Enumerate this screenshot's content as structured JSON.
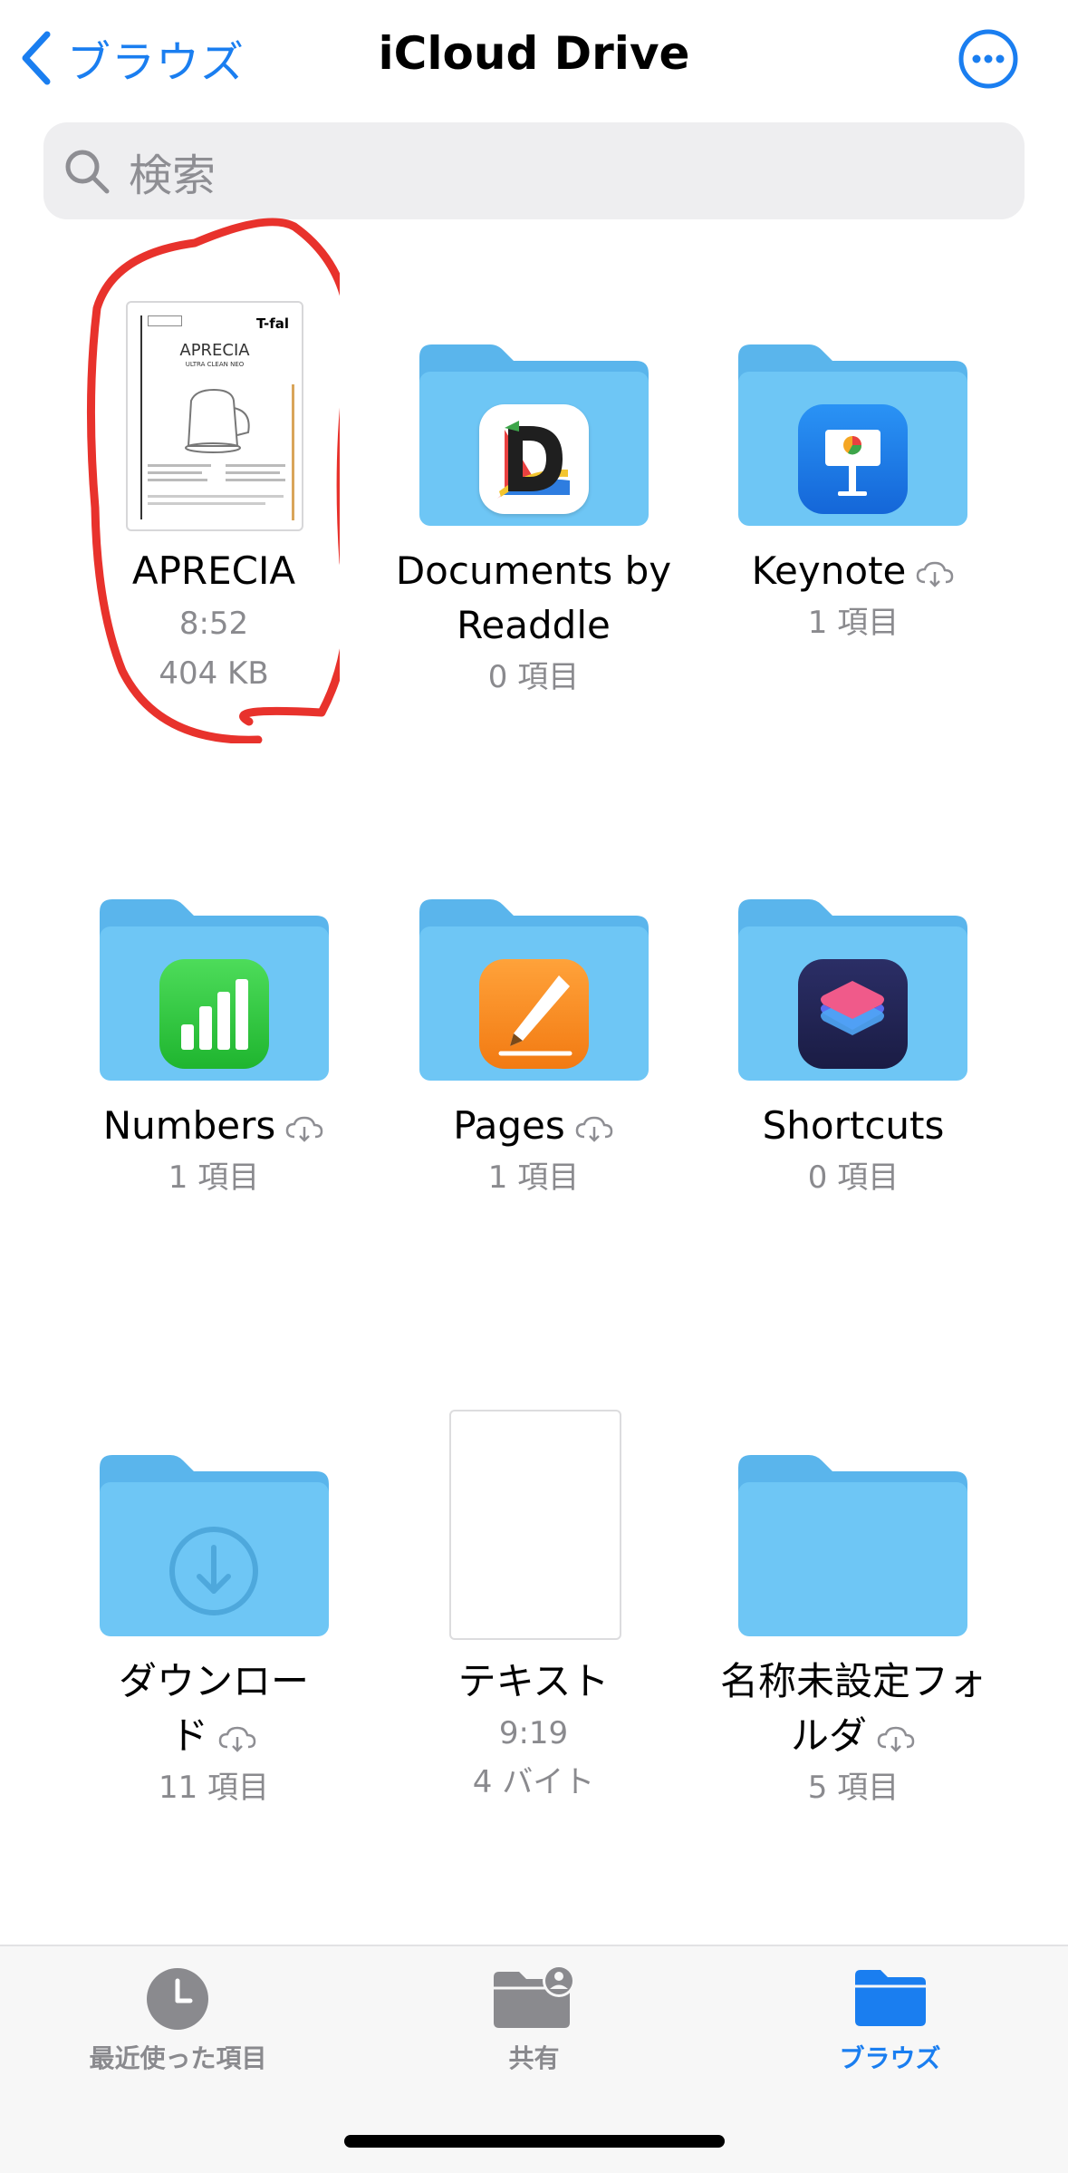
{
  "nav": {
    "back_label": "ブラウズ",
    "title": "iCloud Drive"
  },
  "search": {
    "placeholder": "検索"
  },
  "items": [
    {
      "name": "APRECIA",
      "meta1": "8:52",
      "meta2": "404 KB",
      "kind": "document-thumbnail",
      "thumb_text": [
        "T-fal",
        "APRECIA",
        "ULTRA CLEAN NEO"
      ]
    },
    {
      "name_line1": "Documents by",
      "name_line2": "Readdle",
      "meta1": "0 項目",
      "kind": "folder",
      "app": "documents-app-icon"
    },
    {
      "name": "Keynote",
      "meta1": "1 項目",
      "kind": "folder",
      "app": "keynote-app-icon",
      "cloud": true
    },
    {
      "name": "Numbers",
      "meta1": "1 項目",
      "kind": "folder",
      "app": "numbers-app-icon",
      "cloud": true
    },
    {
      "name": "Pages",
      "meta1": "1 項目",
      "kind": "folder",
      "app": "pages-app-icon",
      "cloud": true
    },
    {
      "name": "Shortcuts",
      "meta1": "0 項目",
      "kind": "folder",
      "app": "shortcuts-app-icon"
    },
    {
      "name_line1": "ダウンロー",
      "name_line2": "ド",
      "meta1": "11 項目",
      "kind": "folder",
      "app": "download-arrow-icon",
      "cloud": true
    },
    {
      "name": "テキスト",
      "meta1": "9:19",
      "meta2": "4 バイト",
      "kind": "blank-document"
    },
    {
      "name_line1": "名称未設定フォ",
      "name_line2": "ルダ",
      "meta1": "5 項目",
      "kind": "folder",
      "cloud": true
    }
  ],
  "tabs": [
    {
      "label": "最近使った項目",
      "icon": "clock-icon"
    },
    {
      "label": "共有",
      "icon": "shared-folder-icon"
    },
    {
      "label": "ブラウズ",
      "icon": "folder-icon",
      "active": true
    }
  ],
  "colors": {
    "accent": "#1a7ef0",
    "folder_back": "#5ab5ec",
    "folder_front": "#6ec6f5",
    "annotation": "#e8322c",
    "secondary_text": "#8a8a8e"
  }
}
